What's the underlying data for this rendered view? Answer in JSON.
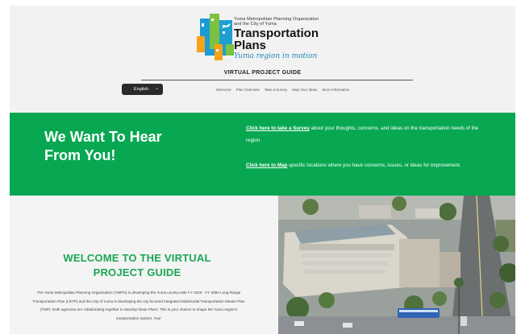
{
  "header": {
    "org_line1": "Yuma Metropolitan Planning Organization",
    "org_line2": "and the City of Yuma",
    "title_line1": "Transportation",
    "title_line2": "Plans",
    "tagline": "Yuma region in motion",
    "guide_title": "VIRTUAL PROJECT GUIDE"
  },
  "language": {
    "selected": "English"
  },
  "nav": [
    "Welcome",
    "Plan Overview",
    "Take a Survey",
    "Map Your Ideas",
    "More Information"
  ],
  "hero": {
    "heading_line1": "We Want To Hear",
    "heading_line2": "From You!",
    "survey_link": "Click here to take a Survey",
    "survey_text": " about your thoughts, concerns, and ideas on the transportation needs of the region.",
    "map_link": "Click here to  Map",
    "map_text": "  specific locations where you have concerns, issues, or ideas for improvement."
  },
  "welcome": {
    "title_line1": "WELCOME TO THE  VIRTUAL",
    "title_line2": "PROJECT GUIDE",
    "body": "The Yuma Metropolitan Planning Organization (YMPO) is developing the Yuma county-wide FY 2026 - FY 2050 Long-Range Transportation Plan (LRTP) and the City of Yuma is developing the city-focused Integrated Multimodal Transportation Master Plan (TMP). Both agencies are collaborating together to develop these Plans. This is your chance to shape the Yuma region's transportation system. Your"
  },
  "colors": {
    "green": "#08a751",
    "title_green": "#1aa655",
    "tagline_blue": "#1d8ab6"
  },
  "icons": {
    "language_chevron": "chevron-down-icon",
    "logo": "yuma-region-logo-icon"
  }
}
